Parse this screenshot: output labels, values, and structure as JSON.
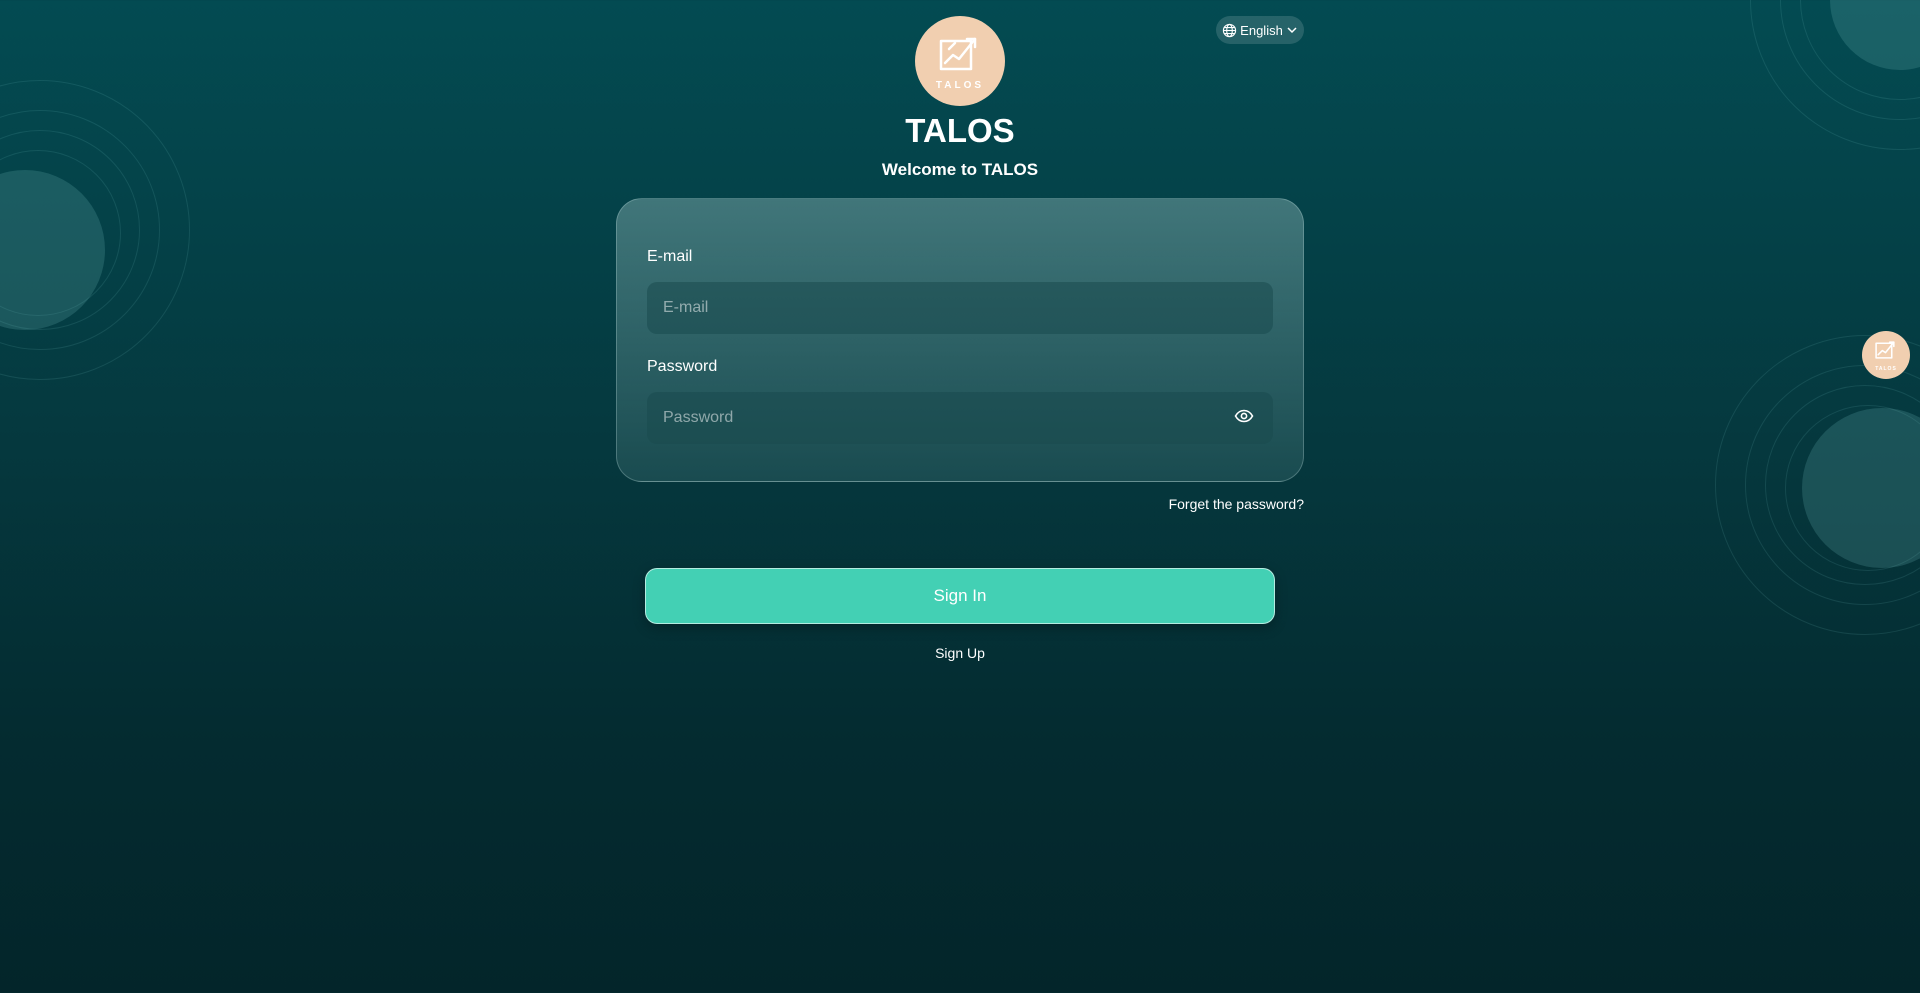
{
  "language": {
    "selected": "English",
    "icon": "globe-icon"
  },
  "brand": {
    "name": "TALOS",
    "welcome": "Welcome to TALOS",
    "logo_text": "TALOS"
  },
  "form": {
    "email": {
      "label": "E-mail",
      "placeholder": "E-mail"
    },
    "password": {
      "label": "Password",
      "placeholder": "Password",
      "toggle_icon": "eye-icon"
    },
    "forgot_label": "Forget the password?"
  },
  "actions": {
    "signin_label": "Sign In",
    "signup_label": "Sign Up"
  },
  "colors": {
    "background_top": "#034b52",
    "background_bottom": "#03252a",
    "accent": "#43d0b4",
    "logo_bg": "#f1cfb0"
  }
}
